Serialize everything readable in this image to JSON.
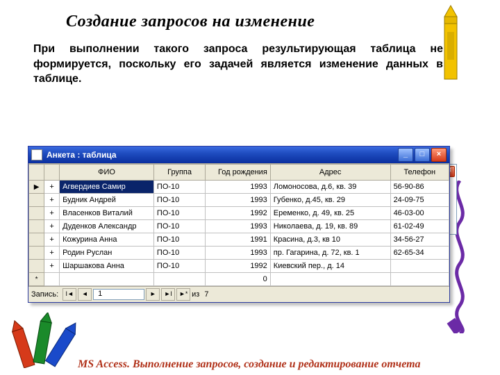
{
  "heading": "Создание запросов на изменение",
  "body": "При выполнении такого запроса результирующая таблица не формируется, поскольку его задачей является изменение данных в таблице.",
  "footer": "MS Access. Выполнение запросов, создание и редактирование отчета",
  "window": {
    "title": "Анкета : таблица",
    "columns": [
      "ФИО",
      "Группа",
      "Год рождения",
      "Адрес",
      "Телефон"
    ],
    "rows": [
      {
        "marker": "▶",
        "fio": "Агвердиев Самир",
        "group": "ПО-10",
        "year": "1993",
        "addr": "Ломоносова, д.6, кв. 39",
        "phone": "56-90-86",
        "selected": true
      },
      {
        "marker": "",
        "fio": "Будник Андрей",
        "group": "ПО-10",
        "year": "1993",
        "addr": "Губенко, д.45, кв. 29",
        "phone": "24-09-75"
      },
      {
        "marker": "",
        "fio": "Власенков Виталий",
        "group": "ПО-10",
        "year": "1992",
        "addr": "Еременко, д. 49, кв. 25",
        "phone": "46-03-00"
      },
      {
        "marker": "",
        "fio": "Дуденков Александр",
        "group": "ПО-10",
        "year": "1993",
        "addr": "Николаева, д. 19, кв. 89",
        "phone": "61-02-49"
      },
      {
        "marker": "",
        "fio": "Кожурина Анна",
        "group": "ПО-10",
        "year": "1991",
        "addr": "Красина, д.3, кв 10",
        "phone": "34-56-27"
      },
      {
        "marker": "",
        "fio": "Родин Руслан",
        "group": "ПО-10",
        "year": "1993",
        "addr": "пр. Гагарина, д. 72, кв. 1",
        "phone": "62-65-34"
      },
      {
        "marker": "",
        "fio": "Шаршакова Анна",
        "group": "ПО-10",
        "year": "1992",
        "addr": "Киевский пер., д. 14",
        "phone": ""
      },
      {
        "marker": "*",
        "fio": "",
        "group": "",
        "year": "0",
        "addr": "",
        "phone": "",
        "newrow": true
      }
    ],
    "nav": {
      "label": "Запись:",
      "current": "1",
      "of_label": "из",
      "total": "7"
    }
  }
}
